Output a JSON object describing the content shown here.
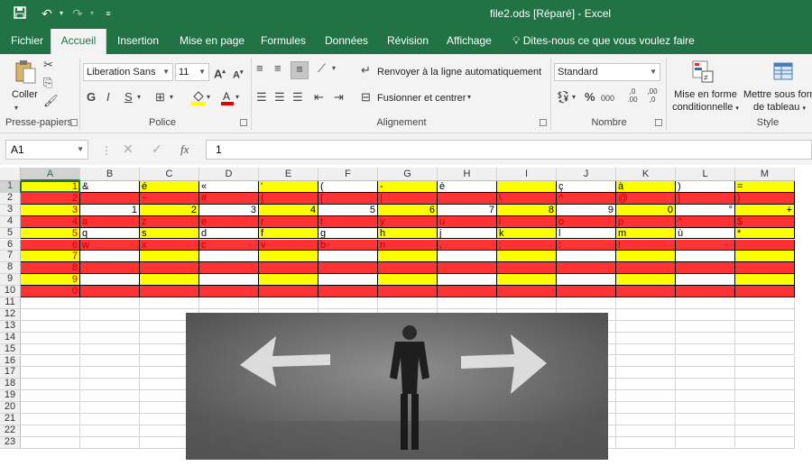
{
  "titlebar": {
    "title": "file2.ods [Réparé] - Excel",
    "save_icon": "save-icon",
    "undo_icon": "undo-icon",
    "redo_icon": "redo-icon",
    "customize_icon": "customize-qat-icon"
  },
  "tabs": [
    "Fichier",
    "Accueil",
    "Insertion",
    "Mise en page",
    "Formules",
    "Données",
    "Révision",
    "Affichage"
  ],
  "tell_me": "Dites-nous ce que vous voulez faire",
  "ribbon": {
    "clipboard": {
      "paste": "Coller",
      "label": "Presse-papiers"
    },
    "font": {
      "name": "Liberation Sans",
      "size": "11",
      "bold": "G",
      "italic": "I",
      "underline": "S",
      "label": "Police"
    },
    "alignment": {
      "wrap": "Renvoyer à la ligne automatiquement",
      "merge": "Fusionner et centrer",
      "label": "Alignement"
    },
    "number": {
      "format": "Standard",
      "label": "Nombre",
      "percent": "%",
      "thousands": "000",
      "inc": ",0 .00",
      "dec": ",00 ,0"
    },
    "style": {
      "conditional": "Mise en forme",
      "conditional2": "conditionnelle",
      "table": "Mettre sous forme",
      "table2": "de tableau",
      "label": "Style"
    }
  },
  "formula_bar": {
    "name_box": "A1",
    "formula": "1",
    "fx": "fx"
  },
  "columns": [
    "A",
    "B",
    "C",
    "D",
    "E",
    "F",
    "G",
    "H",
    "I",
    "J",
    "K",
    "L",
    "M"
  ],
  "rows": [
    "1",
    "2",
    "3",
    "4",
    "5",
    "6",
    "7",
    "8",
    "9",
    "10",
    "11",
    "12",
    "13",
    "14",
    "15",
    "16",
    "17",
    "18",
    "19",
    "20",
    "21",
    "22",
    "23"
  ],
  "cells": [
    [
      "1",
      "&",
      "é",
      "«",
      "'",
      "(",
      "-",
      "è",
      "",
      "ç",
      "à",
      ")",
      "="
    ],
    [
      "2",
      "",
      "~",
      "#",
      "{",
      "[",
      "|",
      "",
      "\\",
      "^",
      "@",
      "]",
      "}"
    ],
    [
      "3",
      "1",
      "2",
      "3",
      "4",
      "5",
      "6",
      "7",
      "8",
      "9",
      "0",
      "°",
      "+"
    ],
    [
      "4",
      "a",
      "z",
      "e",
      "r",
      "t",
      "y",
      "u",
      "i",
      "o",
      "p",
      "^",
      "$"
    ],
    [
      "5",
      "q",
      "s",
      "d",
      "f",
      "g",
      "h",
      "j",
      "k",
      "l",
      "m",
      "ù",
      "*"
    ],
    [
      "6",
      "w",
      "x",
      "c",
      "v",
      "b",
      "n",
      ",",
      ";",
      ":",
      "!",
      "",
      ""
    ],
    [
      "7",
      "",
      "",
      "",
      "",
      "",
      "",
      "",
      "",
      "",
      "",
      "",
      ""
    ],
    [
      "8",
      "",
      "",
      "",
      "",
      "",
      "",
      "",
      "",
      "",
      "",
      "",
      ""
    ],
    [
      "9",
      "",
      "",
      "",
      "",
      "",
      "",
      "",
      "",
      "",
      "",
      "",
      ""
    ],
    [
      "0",
      "",
      "",
      "",
      "",
      "",
      "",
      "",
      "",
      "",
      "",
      "",
      ""
    ]
  ],
  "colors": {
    "brand": "#217346",
    "yellow": "#ffff00",
    "red": "#ff3333"
  }
}
